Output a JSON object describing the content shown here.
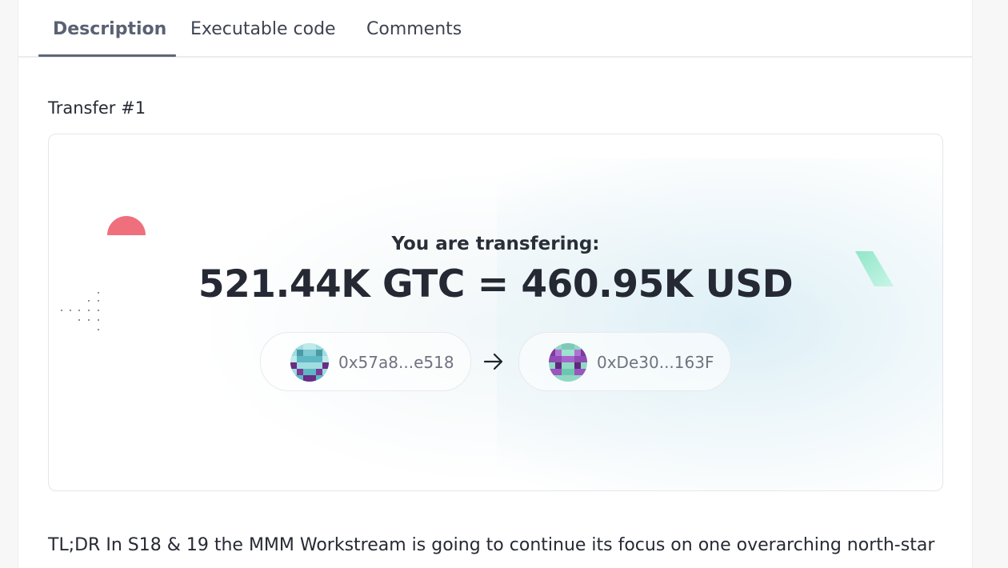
{
  "tabs": [
    {
      "label": "Description",
      "active": true
    },
    {
      "label": "Executable code",
      "active": false
    },
    {
      "label": "Comments",
      "active": false
    }
  ],
  "section_title": "Transfer #1",
  "transfer": {
    "label": "You are transfering:",
    "amount": "521.44K GTC = 460.95K USD",
    "from_address": "0x57a8...e518",
    "to_address": "0xDe30...163F",
    "arrow_icon": "arrow-right-icon"
  },
  "description": "TL;DR In S18 & 19 the MMM Workstream is going to continue its focus on one overarching north-star",
  "colors": {
    "accent_red": "#ef6f7d",
    "accent_green": "#a8ecd6",
    "tab_active": "#5a6173"
  }
}
